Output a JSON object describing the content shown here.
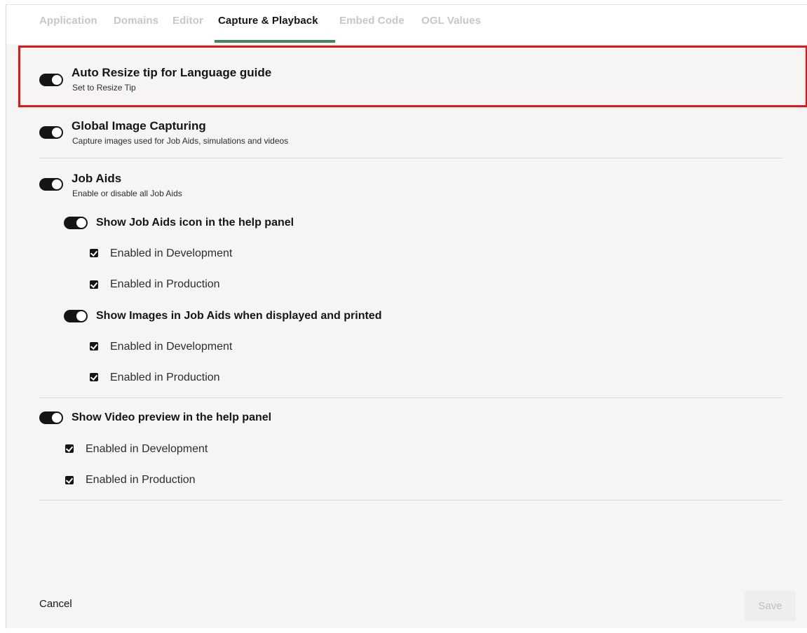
{
  "tabs": [
    {
      "label": "Application",
      "active": false
    },
    {
      "label": "Domains",
      "active": false
    },
    {
      "label": "Editor",
      "active": false
    },
    {
      "label": "Capture & Playback",
      "active": true
    },
    {
      "label": "Embed Code",
      "active": false
    },
    {
      "label": "OGL Values",
      "active": false
    }
  ],
  "settings": {
    "auto_resize": {
      "title": "Auto Resize tip for Language guide",
      "description": "Set to Resize Tip",
      "enabled": true
    },
    "global_image": {
      "title": "Global Image Capturing",
      "description": "Capture images used for Job Aids, simulations and videos",
      "enabled": true
    },
    "job_aids": {
      "title": "Job Aids",
      "description": "Enable or disable all Job Aids",
      "enabled": true,
      "icon_option": {
        "title": "Show Job Aids icon in the help panel",
        "enabled": true,
        "development": {
          "label": "Enabled in Development",
          "checked": true
        },
        "production": {
          "label": "Enabled in Production",
          "checked": true
        }
      },
      "images_option": {
        "title": "Show Images in Job Aids when displayed and printed",
        "enabled": true,
        "development": {
          "label": "Enabled in Development",
          "checked": true
        },
        "production": {
          "label": "Enabled in Production",
          "checked": true
        }
      }
    },
    "video_preview": {
      "title": "Show Video preview in the help panel",
      "enabled": true,
      "development": {
        "label": "Enabled in Development",
        "checked": true
      },
      "production": {
        "label": "Enabled in Production",
        "checked": true
      }
    }
  },
  "footer": {
    "cancel_label": "Cancel",
    "save_label": "Save",
    "save_enabled": false
  },
  "colors": {
    "accent_tab": "#3f8a5a",
    "highlight": "#e0161b",
    "toggle_on": "#161513"
  }
}
